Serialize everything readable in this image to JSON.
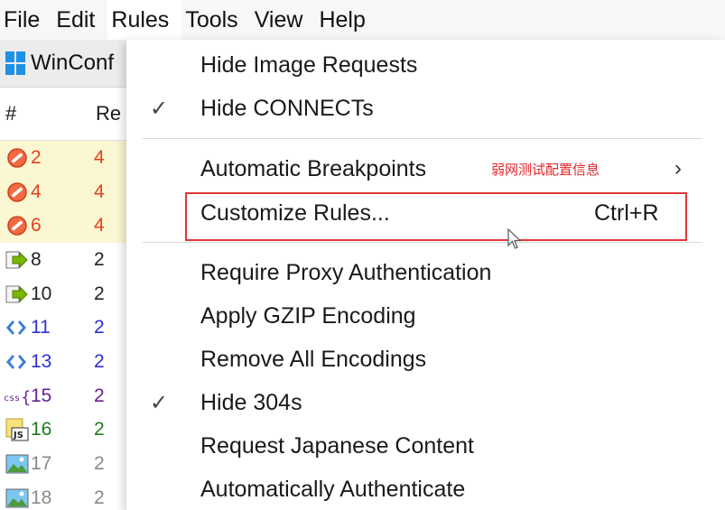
{
  "menubar": {
    "items": [
      "File",
      "Edit",
      "Rules",
      "Tools",
      "View",
      "Help"
    ]
  },
  "sessions": {
    "tab_label": "WinConf",
    "col_hash": "#",
    "col_result": "Re",
    "rows": [
      {
        "num": "2",
        "res": "4",
        "icon": "blocked-icon",
        "color": "#e5411b",
        "highlight": true
      },
      {
        "num": "4",
        "res": "4",
        "icon": "blocked-icon",
        "color": "#e5411b",
        "highlight": true
      },
      {
        "num": "6",
        "res": "4",
        "icon": "blocked-icon",
        "color": "#e5411b",
        "highlight": true
      },
      {
        "num": "8",
        "res": "2",
        "icon": "arrow-right-icon",
        "color": "#222222",
        "highlight": false
      },
      {
        "num": "10",
        "res": "2",
        "icon": "arrow-right-icon",
        "color": "#222222",
        "highlight": false
      },
      {
        "num": "11",
        "res": "2",
        "icon": "code-brackets-icon",
        "color": "#2b30d8",
        "highlight": false
      },
      {
        "num": "13",
        "res": "2",
        "icon": "code-brackets-icon",
        "color": "#2b30d8",
        "highlight": false
      },
      {
        "num": "15",
        "res": "2",
        "icon": "css-icon",
        "color": "#6b1e9a",
        "highlight": false
      },
      {
        "num": "16",
        "res": "2",
        "icon": "js-icon",
        "color": "#1f7a1f",
        "highlight": false
      },
      {
        "num": "17",
        "res": "2",
        "icon": "image-icon",
        "color": "#8a8a8a",
        "highlight": false
      },
      {
        "num": "18",
        "res": "2",
        "icon": "image-icon",
        "color": "#8a8a8a",
        "highlight": false
      }
    ]
  },
  "rules_menu": {
    "hide_image_requests": "Hide Image Requests",
    "hide_connects": "Hide CONNECTs",
    "automatic_breakpoints": "Automatic Breakpoints",
    "annotation": "弱网测试配置信息",
    "customize_rules": "Customize Rules...",
    "customize_shortcut": "Ctrl+R",
    "require_proxy_auth": "Require Proxy Authentication",
    "apply_gzip": "Apply GZIP Encoding",
    "remove_encodings": "Remove All Encodings",
    "hide_304s": "Hide 304s",
    "request_japanese": "Request Japanese Content",
    "auto_authenticate": "Automatically Authenticate",
    "check_glyph": "✓",
    "submenu_glyph": "›"
  },
  "colors": {
    "highlight_box": "#e1363a",
    "annotation_text": "#e5242a",
    "windows_logo": "#1e90e6"
  }
}
